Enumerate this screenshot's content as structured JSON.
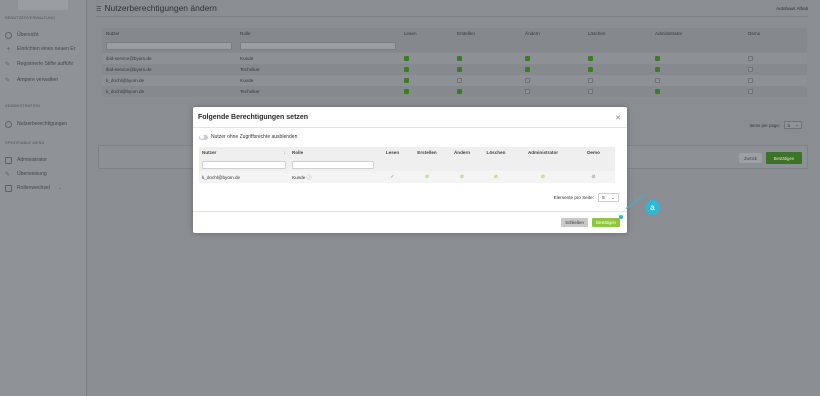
{
  "sidebar": {
    "sections": [
      "BENUTZERVERWALTUNG",
      "ADMINISTRATION",
      "SPEZIFIABLE MENÜ"
    ],
    "items": [
      {
        "label": "Übersicht"
      },
      {
        "label": "Einrichten eines neuen Er"
      },
      {
        "label": "Registrierte Stifte aufführ"
      },
      {
        "label": "Ampere verwalten"
      },
      {
        "label": "Nutzerberechtigungen"
      },
      {
        "label": "Administrator"
      },
      {
        "label": "Überweisung"
      },
      {
        "label": "Rollenwechsel"
      }
    ]
  },
  "header": {
    "title": "Nutzerberechtigungen ändern",
    "user": "Autohaus Albati"
  },
  "bg_table": {
    "columns": [
      "Nutzer",
      "Rolle",
      "Lesen",
      "Erstellen",
      "Ändern",
      "Löschen",
      "Administrator",
      "Demo"
    ],
    "rows": [
      {
        "user": "ibid-service@byom.de",
        "role": "Kunde",
        "perms": [
          true,
          true,
          true,
          true,
          true,
          false
        ]
      },
      {
        "user": "ibid-service@byom.de",
        "role": "Techniker",
        "perms": [
          true,
          true,
          true,
          true,
          true,
          false
        ]
      },
      {
        "user": "k_dochl@byom.de",
        "role": "Kunde",
        "perms": [
          true,
          false,
          false,
          false,
          false,
          false
        ]
      },
      {
        "user": "k_dochl@byom.de",
        "role": "Techniker",
        "perms": [
          true,
          true,
          false,
          false,
          true,
          false
        ]
      }
    ],
    "items_per_page_label": "Items per page:",
    "items_per_page_value": "5"
  },
  "bg_actions": {
    "back": "Zurück",
    "confirm": "Bestätigen"
  },
  "modal": {
    "title": "Folgende Berechtigungen setzen",
    "toggle_label": "Nutzer ohne Zugriffsrechte ausblenden",
    "columns": [
      "Nutzer",
      "Rolle",
      "Lesen",
      "Erstellen",
      "Ändern",
      "Löschen",
      "Administrator",
      "Demo"
    ],
    "row": {
      "user": "k_dochl@byom.de",
      "role": "Kunde"
    },
    "pager_label": "Elemente pro Seite:",
    "pager_value": "5",
    "close_button": "Schließen",
    "apply_button": "Bestätigen"
  },
  "annotation": {
    "badge": "a",
    "color": "#2fb7d5"
  }
}
